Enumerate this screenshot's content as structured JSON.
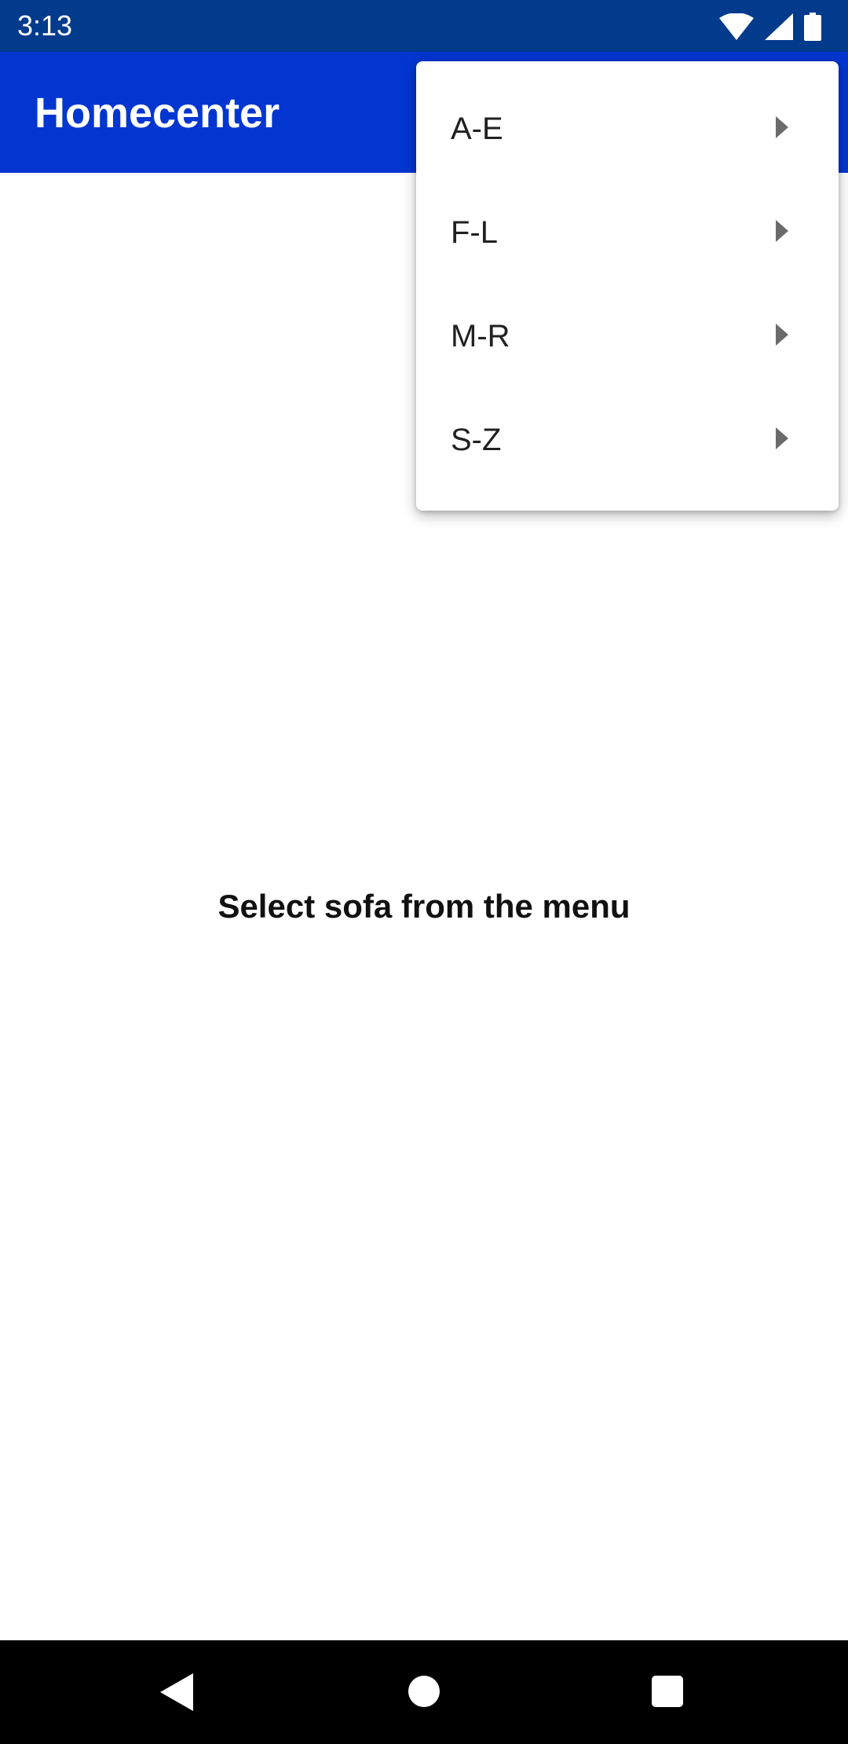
{
  "status_bar": {
    "time": "3:13",
    "icons": [
      "wifi-icon",
      "signal-icon",
      "battery-icon"
    ]
  },
  "app_bar": {
    "title": "Homecenter"
  },
  "content": {
    "message": "Select sofa from the menu"
  },
  "menu": {
    "items": [
      {
        "label": "A-E",
        "icon": "submenu-arrow-icon"
      },
      {
        "label": "F-L",
        "icon": "submenu-arrow-icon"
      },
      {
        "label": "M-R",
        "icon": "submenu-arrow-icon"
      },
      {
        "label": "S-Z",
        "icon": "submenu-arrow-icon"
      }
    ]
  },
  "nav_bar": {
    "icons": [
      "back-icon",
      "home-icon",
      "recents-icon"
    ]
  },
  "colors": {
    "status_bar": "#023a8c",
    "app_bar": "#0336d1",
    "nav_bar": "#000000"
  }
}
